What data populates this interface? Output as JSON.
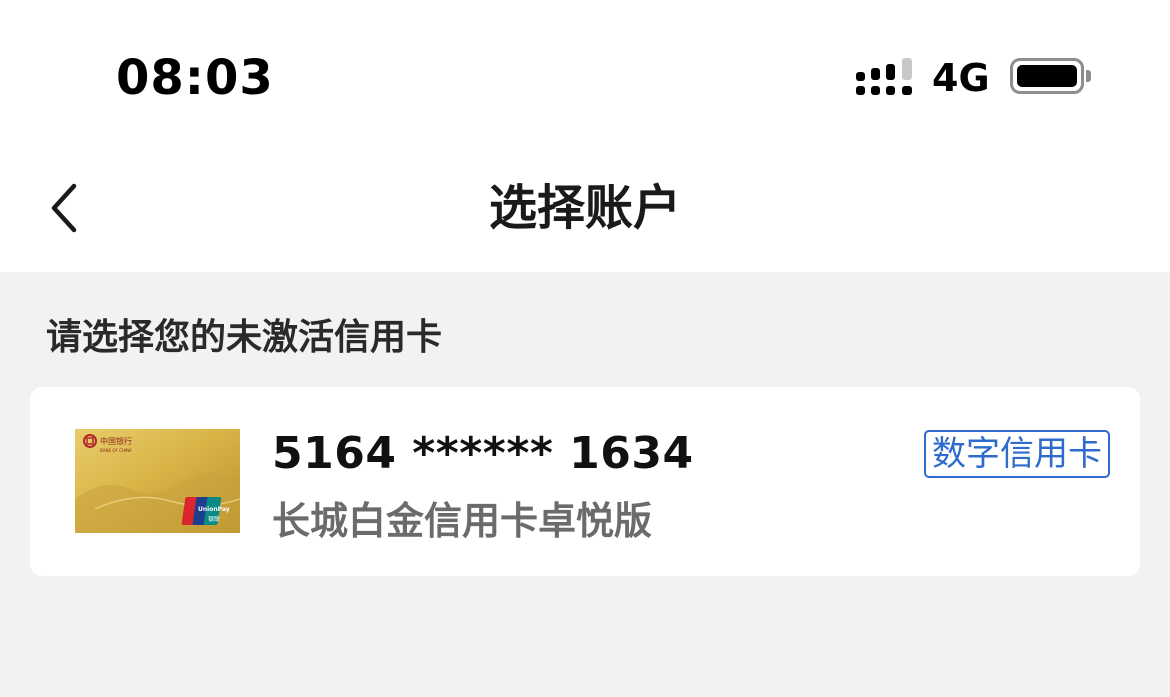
{
  "status_bar": {
    "time": "08:03",
    "network": "4G"
  },
  "nav": {
    "title": "选择账户"
  },
  "section": {
    "label": "请选择您的未激活信用卡"
  },
  "card": {
    "number": "5164 ****** 1634",
    "name": "长城白金信用卡卓悦版",
    "badge": "数字信用卡",
    "bank_logo_text": "中国银行",
    "bank_logo_subtext": "BANK OF CHINA",
    "network_logo_text": "UnionPay 银联"
  },
  "colors": {
    "accent": "#2e6bcc",
    "page_background": "#f2f2f2",
    "card_gold": "#d9b548"
  }
}
